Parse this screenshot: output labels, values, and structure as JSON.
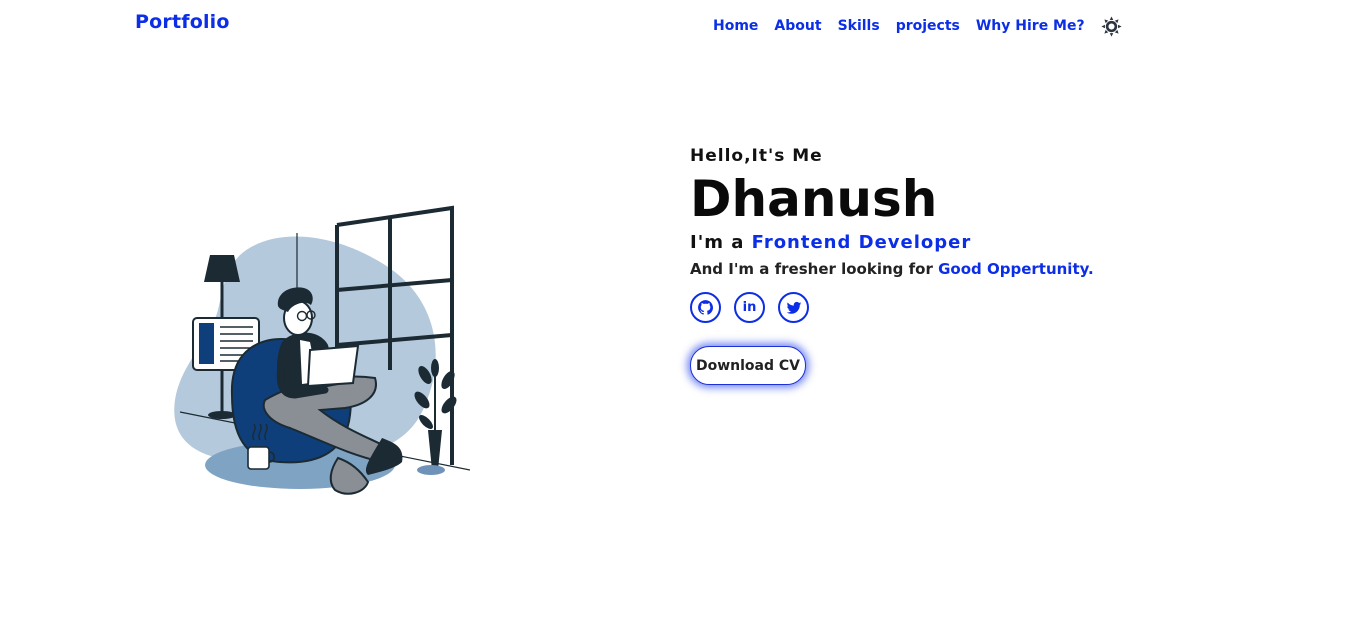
{
  "header": {
    "brand": "Portfolio",
    "nav": [
      {
        "label": "Home"
      },
      {
        "label": "About"
      },
      {
        "label": "Skills"
      },
      {
        "label": "projects"
      },
      {
        "label": "Why Hire Me?"
      }
    ],
    "theme_icon": "gear-sun-icon"
  },
  "hero": {
    "greeting": "Hello,It's Me",
    "name": "Dhanush",
    "role_prefix": "I'm a",
    "role_highlight": "Frontend Developer",
    "sub_prefix": "And I'm a fresher looking for",
    "sub_highlight": "Good Oppertunity.",
    "socials": [
      {
        "icon": "github-icon"
      },
      {
        "icon": "linkedin-icon",
        "text": "in"
      },
      {
        "icon": "twitter-icon"
      }
    ],
    "cta": "Download CV"
  },
  "colors": {
    "accent": "#0b2ee6",
    "illustration_blue": "#0f3f7a",
    "illustration_light": "#a9c2d8"
  }
}
